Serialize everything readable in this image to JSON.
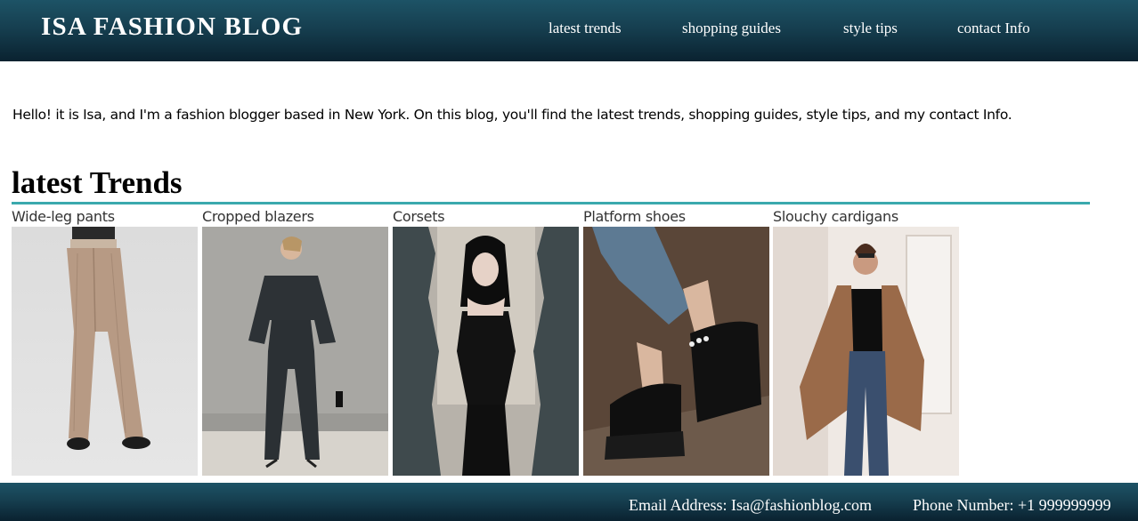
{
  "header": {
    "title": "ISA FASHION BLOG",
    "nav": [
      {
        "label": "latest trends"
      },
      {
        "label": "shopping guides"
      },
      {
        "label": "style tips"
      },
      {
        "label": "contact Info"
      }
    ]
  },
  "intro": {
    "text": "Hello! it is Isa, and I'm a fashion blogger based in New York. On this blog, you'll find the latest trends, shopping guides, style tips, and my contact Info."
  },
  "trends": {
    "heading": "latest Trends",
    "items": [
      {
        "label": "Wide-leg pants",
        "image": "woman-in-beige-wide-leg-pants-photo"
      },
      {
        "label": "Cropped blazers",
        "image": "woman-in-black-cropped-blazer-suit-photo"
      },
      {
        "label": "Corsets",
        "image": "woman-in-black-corset-dress-photo"
      },
      {
        "label": "Platform shoes",
        "image": "black-platform-lace-up-shoes-photo"
      },
      {
        "label": "Slouchy cardigans",
        "image": "woman-in-brown-slouchy-cardigan-photo"
      }
    ]
  },
  "footer": {
    "email": "Email Address: Isa@fashionblog.com",
    "phone": "Phone Number: +1 999999999"
  },
  "colors": {
    "header_bg": "#163f50",
    "accent_rule": "#3aa9ad",
    "text": "#000000"
  }
}
